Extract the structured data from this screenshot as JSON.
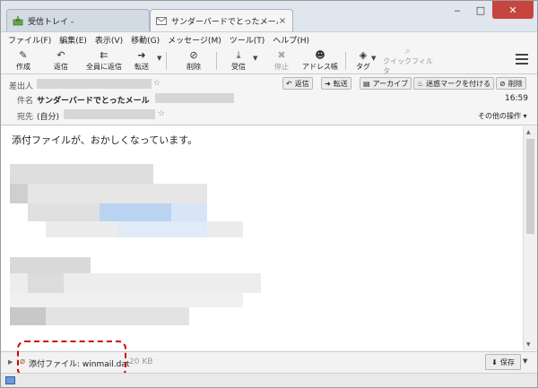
{
  "tabs": [
    {
      "label": "受信トレイ - ",
      "icon": "inbox-icon"
    },
    {
      "label": "サンダーバードでとったメール ...",
      "icon": "mail-icon"
    }
  ],
  "tab_close": "×",
  "window_controls": {
    "minimize": "‒",
    "maximize": "□",
    "close": "✕"
  },
  "menu": [
    "ファイル(F)",
    "編集(E)",
    "表示(V)",
    "移動(G)",
    "メッセージ(M)",
    "ツール(T)",
    "ヘルプ(H)"
  ],
  "toolbar": {
    "compose": "作成",
    "reply": "返信",
    "reply_all": "全員に返信",
    "forward": "転送",
    "delete": "削除",
    "receive": "受信",
    "stop": "停止",
    "address_book": "アドレス帳",
    "tag": "タグ",
    "quick_filter": "クイックフィルタ"
  },
  "header": {
    "from_label": "差出人",
    "subject_label": "件名",
    "to_label": "宛先",
    "subject": "サンダーバードでとったメール",
    "time": "16:59",
    "to": "(自分)",
    "other_actions": "その他の操作 ▾",
    "buttons": {
      "reply": "返信",
      "forward": "転送",
      "archive": "アーカイブ",
      "junk": "迷惑マークを付ける",
      "delete": "削除"
    }
  },
  "body": {
    "text": "添付ファイルが、おかしくなっています。"
  },
  "attachment": {
    "label": "添付ファイル: winmail.dat",
    "size": "20 KB",
    "save": "保存"
  },
  "colors": {
    "highlight": "#d40000",
    "close_button": "#c7453f"
  }
}
